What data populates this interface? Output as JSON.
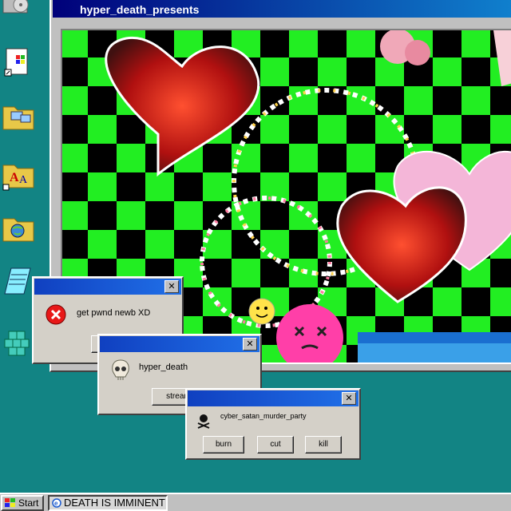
{
  "main_window": {
    "title": "hyper_death_presents"
  },
  "dialogs": {
    "error": {
      "message": "get pwnd newb XD",
      "close": "✕"
    },
    "hyper": {
      "message": "hyper_death",
      "button": "stream now",
      "close": "✕"
    },
    "cyber": {
      "message": "cyber_satan_murder_party",
      "buttons": [
        "burn",
        "cut",
        "kill"
      ],
      "close": "✕"
    }
  },
  "taskbar": {
    "start_label": "Start",
    "task_label": "DEATH IS IMMINENT"
  },
  "desktop_icons": [
    "cd-drive-icon",
    "windows-setup-icon",
    "network-folder-icon",
    "fonts-folder-icon",
    "internet-folder-icon",
    "notepad-icon",
    "cubes-icon"
  ],
  "colors": {
    "desktop": "#128484",
    "title_bar": "#00007a",
    "dialog_title": "#1040c0",
    "checker_green": "#22ee22"
  }
}
